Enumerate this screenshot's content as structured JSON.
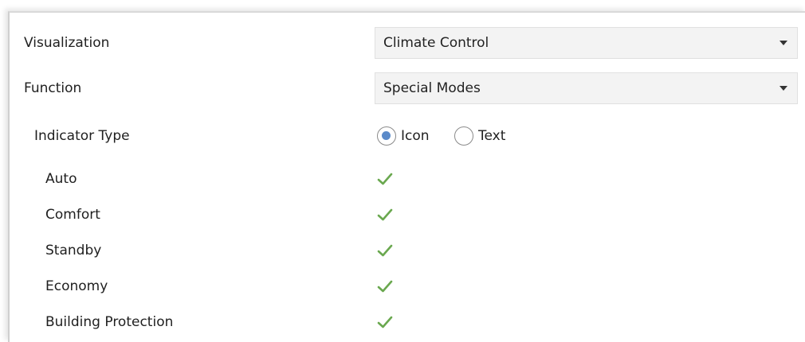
{
  "visualization": {
    "label": "Visualization",
    "value": "Climate Control"
  },
  "function": {
    "label": "Function",
    "value": "Special Modes"
  },
  "indicator_type": {
    "label": "Indicator Type",
    "options": [
      "Icon",
      "Text"
    ],
    "selected": "Icon"
  },
  "modes": [
    {
      "label": "Auto",
      "checked": true
    },
    {
      "label": "Comfort",
      "checked": true
    },
    {
      "label": "Standby",
      "checked": true
    },
    {
      "label": "Economy",
      "checked": true
    },
    {
      "label": "Building Protection",
      "checked": true
    }
  ],
  "colors": {
    "check": "#6aa84f",
    "radio_selected": "#5b8ac9"
  }
}
